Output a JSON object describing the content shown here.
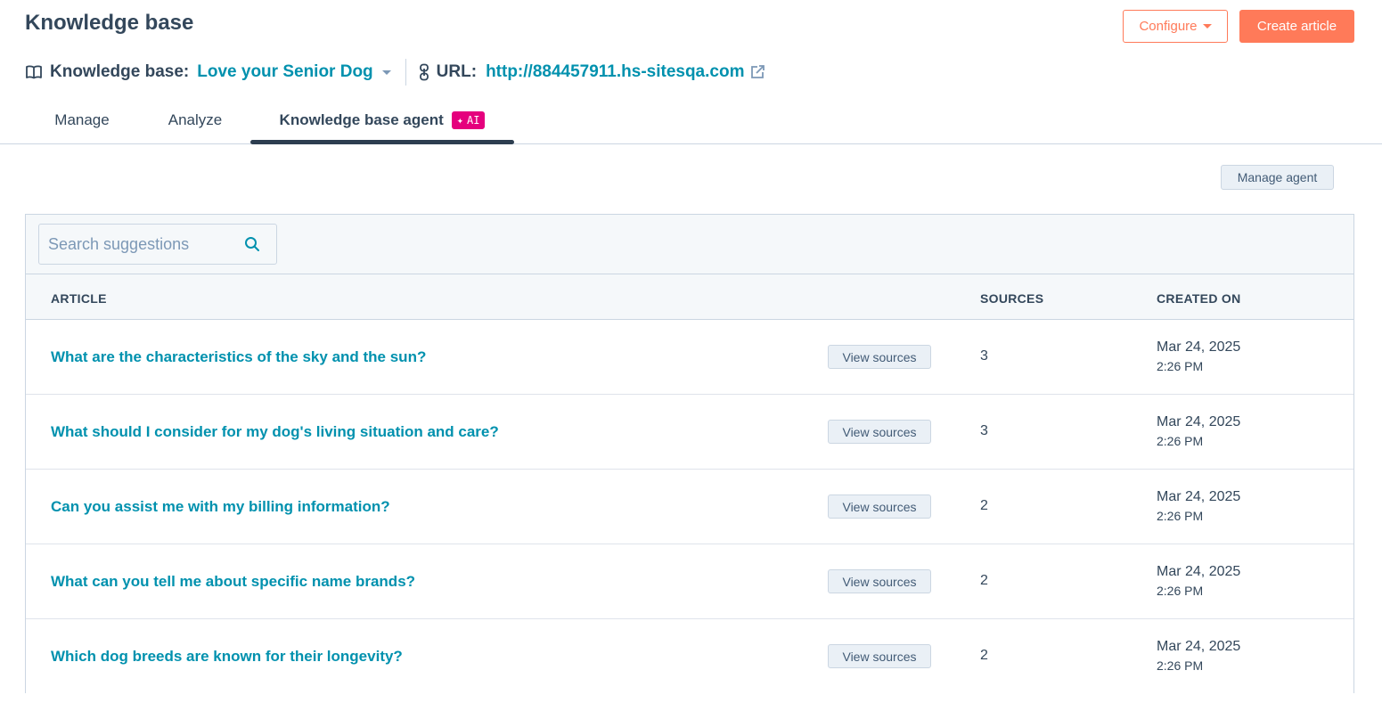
{
  "header": {
    "title": "Knowledge base",
    "configure_label": "Configure",
    "create_label": "Create article"
  },
  "kb": {
    "label": "Knowledge base:",
    "name": "Love your Senior Dog",
    "url_label": "URL:",
    "url": "http://884457911.hs-sitesqa.com"
  },
  "tabs": [
    {
      "label": "Manage"
    },
    {
      "label": "Analyze"
    },
    {
      "label": "Knowledge base agent",
      "badge": "AI"
    }
  ],
  "manage_agent_label": "Manage agent",
  "search": {
    "placeholder": "Search suggestions"
  },
  "table": {
    "columns": [
      "ARTICLE",
      "SOURCES",
      "CREATED ON"
    ],
    "view_sources_label": "View sources",
    "rows": [
      {
        "title": "What are the characteristics of the sky and the sun?",
        "sources": "3",
        "date": "Mar 24, 2025",
        "time": "2:26 PM"
      },
      {
        "title": "What should I consider for my dog's living situation and care?",
        "sources": "3",
        "date": "Mar 24, 2025",
        "time": "2:26 PM"
      },
      {
        "title": "Can you assist me with my billing information?",
        "sources": "2",
        "date": "Mar 24, 2025",
        "time": "2:26 PM"
      },
      {
        "title": "What can you tell me about specific name brands?",
        "sources": "2",
        "date": "Mar 24, 2025",
        "time": "2:26 PM"
      },
      {
        "title": "Which dog breeds are known for their longevity?",
        "sources": "2",
        "date": "Mar 24, 2025",
        "time": "2:26 PM"
      }
    ]
  },
  "colors": {
    "accent": "#ff7a59",
    "link": "#0091ae",
    "ai_badge": "#e5007d"
  },
  "icons": [
    "book-icon",
    "link-icon",
    "external-link-icon",
    "search-icon",
    "sparkle-icon"
  ]
}
